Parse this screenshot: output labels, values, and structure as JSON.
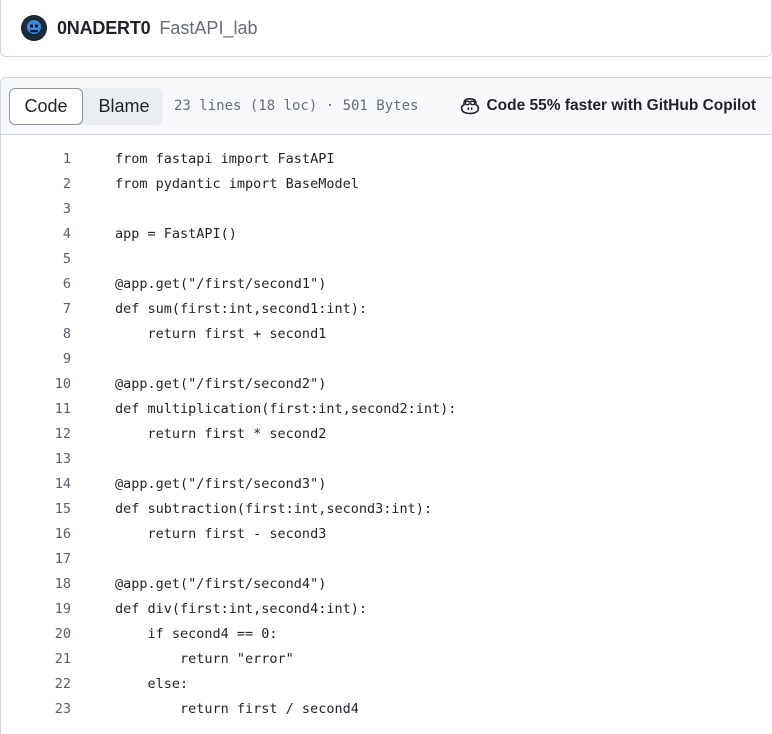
{
  "repo_bar": {
    "owner": "0NADERT0",
    "repo_name": "FastAPI_lab",
    "avatar_icon": "user-avatar-icon"
  },
  "file_header": {
    "code_tab": "Code",
    "blame_tab": "Blame",
    "file_info": "23 lines (18 loc) · 501 Bytes",
    "copilot_icon": "copilot-icon",
    "copilot_text": "Code 55% faster with GitHub Copilot"
  },
  "code_lines": [
    {
      "n": "1",
      "text": "from fastapi import FastAPI"
    },
    {
      "n": "2",
      "text": "from pydantic import BaseModel"
    },
    {
      "n": "3",
      "text": ""
    },
    {
      "n": "4",
      "text": "app = FastAPI()"
    },
    {
      "n": "5",
      "text": ""
    },
    {
      "n": "6",
      "text": "@app.get(\"/first/second1\")"
    },
    {
      "n": "7",
      "text": "def sum(first:int,second1:int):"
    },
    {
      "n": "8",
      "text": "    return first + second1"
    },
    {
      "n": "9",
      "text": ""
    },
    {
      "n": "10",
      "text": "@app.get(\"/first/second2\")"
    },
    {
      "n": "11",
      "text": "def multiplication(first:int,second2:int):"
    },
    {
      "n": "12",
      "text": "    return first * second2"
    },
    {
      "n": "13",
      "text": ""
    },
    {
      "n": "14",
      "text": "@app.get(\"/first/second3\")"
    },
    {
      "n": "15",
      "text": "def subtraction(first:int,second3:int):"
    },
    {
      "n": "16",
      "text": "    return first - second3"
    },
    {
      "n": "17",
      "text": ""
    },
    {
      "n": "18",
      "text": "@app.get(\"/first/second4\")"
    },
    {
      "n": "19",
      "text": "def div(first:int,second4:int):"
    },
    {
      "n": "20",
      "text": "    if second4 == 0:"
    },
    {
      "n": "21",
      "text": "        return \"error\""
    },
    {
      "n": "22",
      "text": "    else:"
    },
    {
      "n": "23",
      "text": "        return first / second4"
    }
  ]
}
